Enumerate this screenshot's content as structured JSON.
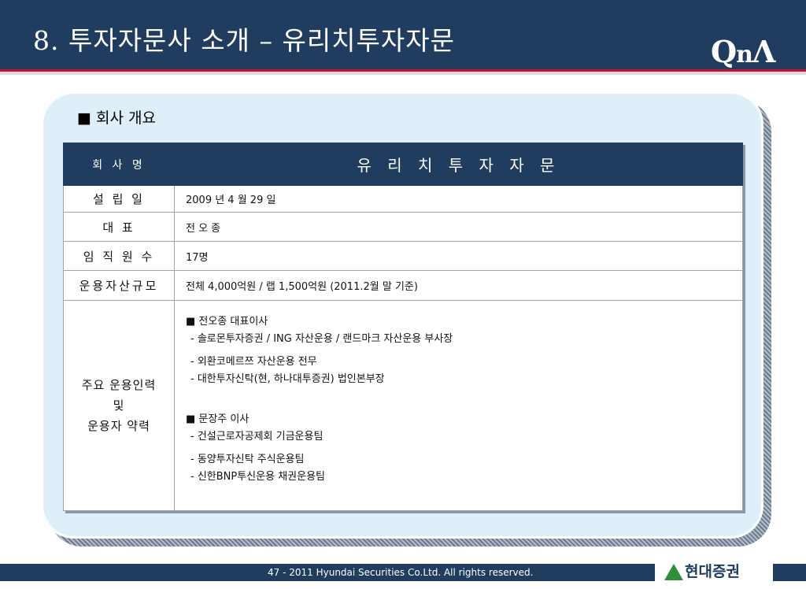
{
  "header": {
    "title": "8. 투자자문사 소개 – 유리치투자자문",
    "logo_q": "Q",
    "logo_n": "n",
    "logo_a": "Λ"
  },
  "section": {
    "bullet": "■",
    "heading": "회사 개요"
  },
  "table": {
    "company_label": "회 사 명",
    "company_name": "유 리 치 투 자 자 문",
    "rows": [
      {
        "label": "설 립 일",
        "value": "2009 년 4 월 29 일"
      },
      {
        "label": "대 표",
        "value": "전 오 종"
      },
      {
        "label": "임 직 원 수",
        "value": "17명"
      },
      {
        "label": "운용자산규모",
        "value": "전체 4,000억원 / 랩 1,500억원 (2011.2월 말 기준)"
      }
    ],
    "staff": {
      "label_line1": "주요 운용인력",
      "label_line2": "및",
      "label_line3": "운용자 약력",
      "person1": {
        "title": "■ 전오종 대표이사",
        "career": [
          "- 솔로몬투자증권 / ING 자산운용 / 랜드마크 자산운용 부사장",
          "- 외환코메르쯔 자산운용 전무",
          "- 대한투자신탁(현, 하나대투증권) 법인본부장"
        ]
      },
      "person2": {
        "title": "■ 문장주 이사",
        "career": [
          "- 건설근로자공제회 기금운용팀",
          "- 동양투자신탁 주식운용팀",
          "- 신한BNP투신운용 채권운용팀"
        ]
      }
    }
  },
  "footer": {
    "copyright": "47 - 2011 Hyundai Securities Co.Ltd. All rights reserved.",
    "brand": "현대증권",
    "brand_color": "#2f8f3a"
  },
  "colors": {
    "header_bg": "#203d5f",
    "accent_red": "#c8102e",
    "panel_bg": "#deeffa"
  }
}
